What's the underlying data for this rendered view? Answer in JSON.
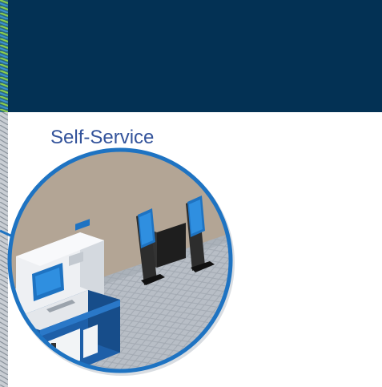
{
  "header": {
    "background": "#033154"
  },
  "section": {
    "title": "Self-Service",
    "title_color": "#33539b"
  },
  "illustration": {
    "subject": "self-service-kiosks",
    "circle_color": "#1e73c2"
  }
}
